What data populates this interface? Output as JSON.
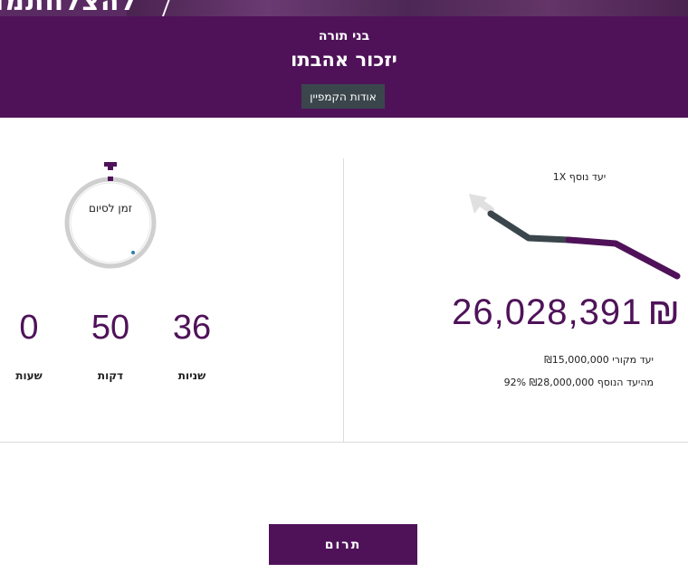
{
  "banner": {
    "text": "להצלחתמו"
  },
  "header": {
    "org_name": "בני תורה",
    "campaign_title": "יזכור אהבתו",
    "about_button": "אודות הקמפיין"
  },
  "progress": {
    "multiplier_label": "1X יעד נוסף",
    "amount": "26,028,391",
    "currency_symbol": "₪",
    "original_goal": "יעד מקורי ₪15,000,000",
    "bonus_goal": "92% מהיעד הנוסף ₪28,000,000",
    "bonus_progress_percent": 92
  },
  "timer": {
    "label": "זמן לסיום",
    "seconds": "36",
    "seconds_label": "שניות",
    "minutes": "50",
    "minutes_label": "דקות",
    "hours": "0",
    "hours_label": "שעות"
  },
  "donate": {
    "label": "תרום"
  },
  "colors": {
    "brand": "#4f1259",
    "dark_slate": "#3a464c",
    "arrow_grey": "#e0e0e0"
  }
}
